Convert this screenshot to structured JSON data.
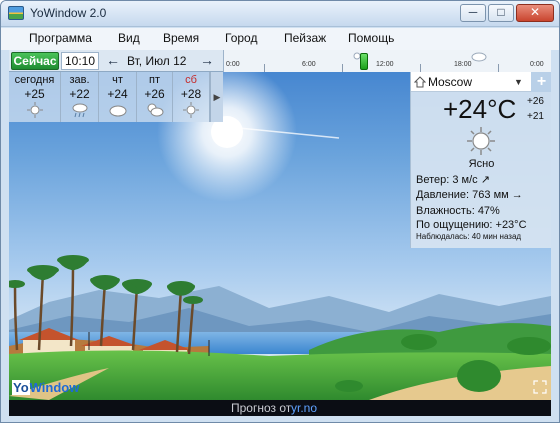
{
  "window": {
    "title": "YoWindow 2.0",
    "controls": {
      "minimize": "─",
      "maximize": "□",
      "close": "✕"
    }
  },
  "menu": [
    "Программа",
    "Вид",
    "Время",
    "Город",
    "Пейзаж",
    "Помощь"
  ],
  "toolbar": {
    "now_label": "Сейчас",
    "time": "10:10",
    "prev_arrow": "←",
    "next_arrow": "→",
    "date": "Вт, Июл 12",
    "timeline_ticks": [
      "0:00",
      "6:00",
      "12:00",
      "18:00",
      "0:00"
    ]
  },
  "forecast": {
    "days": [
      {
        "name": "сегодня",
        "temp": "+25",
        "icon": "sun-icon"
      },
      {
        "name": "зав.",
        "temp": "+22",
        "icon": "rain-cloud-icon"
      },
      {
        "name": "чт",
        "temp": "+24",
        "icon": "cloud-icon"
      },
      {
        "name": "пт",
        "temp": "+26",
        "icon": "sun-cloud-icon"
      },
      {
        "name": "сб",
        "temp": "+28",
        "icon": "sun-icon",
        "weekend_color": "#c62a2a"
      }
    ],
    "expand_arrow": "▶"
  },
  "current": {
    "city": "Moscow",
    "dropdown_arrow": "▼",
    "add_label": "+",
    "temperature": "+24°C",
    "high": "+26",
    "low": "+21",
    "condition": "Ясно",
    "condition_icon": "sun-icon",
    "wind_label": "Ветер:",
    "wind_value": "3 м/с",
    "wind_arrow": "↗",
    "pressure_label": "Давление:",
    "pressure_value": "763 мм",
    "pressure_arrow": "→",
    "humidity_label": "Влажность:",
    "humidity_value": "47%",
    "feels_label": "По ощущению:",
    "feels_value": "+23°C",
    "observed": "Наблюдалась:  40 мин назад"
  },
  "branding": {
    "logo_yo": "Yo",
    "logo_window": "Window"
  },
  "status": {
    "prefix": "Прогноз от",
    "link": "yr.no"
  },
  "colors": {
    "now_button": "#1f8c31",
    "sky_top": "#3d7fcd",
    "grass": "#4fb248",
    "link": "#5fa2ff"
  }
}
